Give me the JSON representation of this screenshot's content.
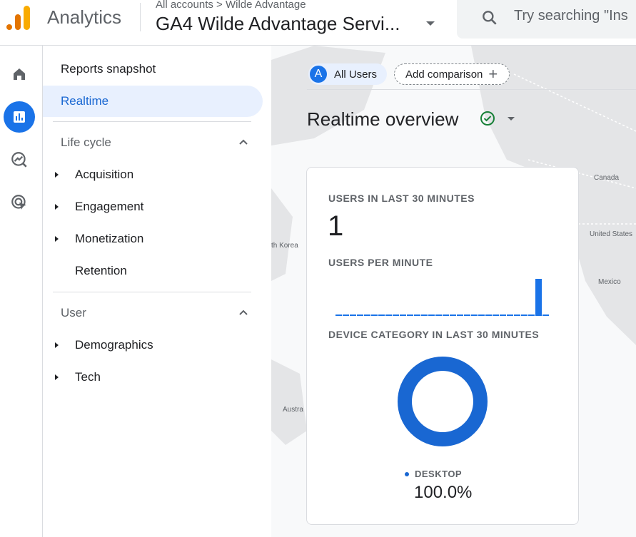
{
  "header": {
    "app_name": "Analytics",
    "breadcrumb": "All accounts > Wilde Advantage",
    "property": "GA4 Wilde Advantage Servi...",
    "search_placeholder": "Try searching \"Ins"
  },
  "rail": [
    {
      "icon": "home-icon"
    },
    {
      "icon": "reports-icon",
      "selected": true
    },
    {
      "icon": "explore-icon"
    },
    {
      "icon": "advertising-icon"
    }
  ],
  "nav": {
    "reports_snapshot": "Reports snapshot",
    "realtime": "Realtime",
    "lifecycle": {
      "label": "Life cycle",
      "items": [
        "Acquisition",
        "Engagement",
        "Monetization",
        "Retention"
      ]
    },
    "user": {
      "label": "User",
      "items": [
        "Demographics",
        "Tech"
      ]
    }
  },
  "main": {
    "segment_letter": "A",
    "segment": "All Users",
    "add_comparison": "Add comparison",
    "title": "Realtime overview",
    "map_labels": [
      "Canada",
      "United States",
      "Mexico",
      "th Korea",
      "Austra"
    ],
    "card": {
      "users_label": "USERS IN LAST 30 MINUTES",
      "users_value": "1",
      "per_minute_label": "USERS PER MINUTE",
      "device_label": "DEVICE CATEGORY IN LAST 30 MINUTES",
      "legend": "DESKTOP",
      "percent": "100.0%"
    }
  },
  "chart_data": {
    "type": "bar",
    "title": "USERS PER MINUTE",
    "values": [
      0,
      0,
      0,
      0,
      0,
      0,
      0,
      0,
      0,
      0,
      0,
      0,
      0,
      0,
      0,
      0,
      0,
      0,
      0,
      0,
      0,
      0,
      0,
      0,
      0,
      0,
      0,
      0,
      1,
      0
    ],
    "color": "#1a73e8"
  },
  "donut": {
    "type": "pie",
    "categories": [
      "DESKTOP"
    ],
    "values": [
      100.0
    ],
    "color": "#1967d2"
  },
  "colors": {
    "accent": "#1a73e8",
    "selected_bg": "#e8f0fe",
    "check": "#188038"
  }
}
